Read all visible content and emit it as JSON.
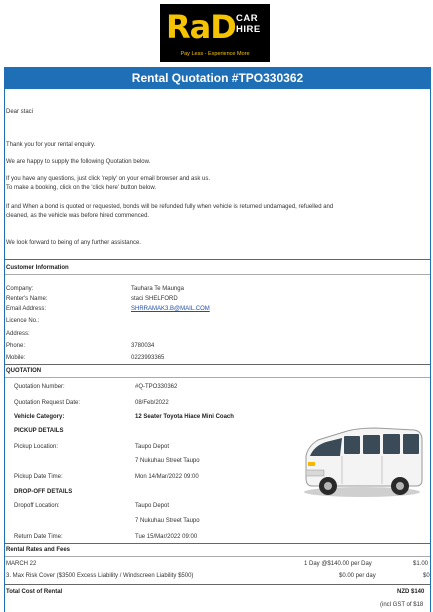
{
  "logo": {
    "brand": "RaD",
    "car_hire_line1": "CAR",
    "car_hire_line2": "HIRE",
    "tagline": "Pay Less - Experience More"
  },
  "title": "Rental Quotation #TPO330362",
  "greeting": "Dear staci",
  "para1": "Thank you for your rental enquiry.",
  "para2": "We are happy to supply the following Quotation below.",
  "para3a": "If you have any questions, just click 'reply' on your email browser and ask us.",
  "para3b": "To make a booking, click on the 'click here' button below.",
  "para4a": "If and When a bond is quoted or requested, bonds will be refunded fully when vehicle is returned undamaged, refuelled and",
  "para4b": "cleaned, as the vehicle was before hired commenced.",
  "para5": "We look forward to being of any further assistance.",
  "customer": {
    "heading": "Customer Information",
    "rows": [
      {
        "label": "Company:",
        "value": "Tauhara Te Maunga"
      },
      {
        "label": "Renter's Name:",
        "value": "staci SHELFORD"
      },
      {
        "label": "Email Address:",
        "value": "SHRRAMAK3.B@MAIL.COM"
      },
      {
        "label": "Licence No.:",
        "value": ""
      },
      {
        "label": "Address:",
        "value": ""
      },
      {
        "label": "Phone:",
        "value": "3780034"
      },
      {
        "label": "Mobile:",
        "value": "0223993365"
      }
    ]
  },
  "quotation": {
    "heading": "QUOTATION",
    "number_label": "Quotation Number:",
    "number_value": "#Q-TPO330362",
    "date_label": "Quotation Request Date:",
    "date_value": "08/Feb/2022",
    "category_label": "Vehicle Category:",
    "category_value": "12 Seater Toyota Hiace Mini Coach",
    "pickup_heading": "PICKUP DETAILS",
    "pickup_loc_label": "Pickup Location:",
    "pickup_loc_value1": "Taupo Depot",
    "pickup_loc_value2": "7 Nukuhau Street Taupo",
    "pickup_time_label": "Pickup Date Time:",
    "pickup_time_value": "Mon 14/Mar/2022 09:00",
    "dropoff_heading": "DROP-OFF DETAILS",
    "dropoff_loc_label": "Dropoff Location:",
    "dropoff_loc_value1": "Taupo Depot",
    "dropoff_loc_value2": "7 Nukuhau Street Taupo",
    "return_label": "Return Date Time:",
    "return_value": "Tue 15/Mar/2022 09:00"
  },
  "rates": {
    "heading": "Rental Rates and Fees",
    "rows": [
      {
        "item": "MARCH 22",
        "rate": "1 Day @$140.00 per Day",
        "amount": "$1.00"
      },
      {
        "item": "3. Max Risk Cover ($3500 Excess Liability / Windscreen Liability $500)",
        "rate": "$0.00 per day",
        "amount": "$0"
      }
    ]
  },
  "total": {
    "label": "Total Cost of Rental",
    "value": "NZD $140",
    "gst": "(incl GST of $18"
  }
}
